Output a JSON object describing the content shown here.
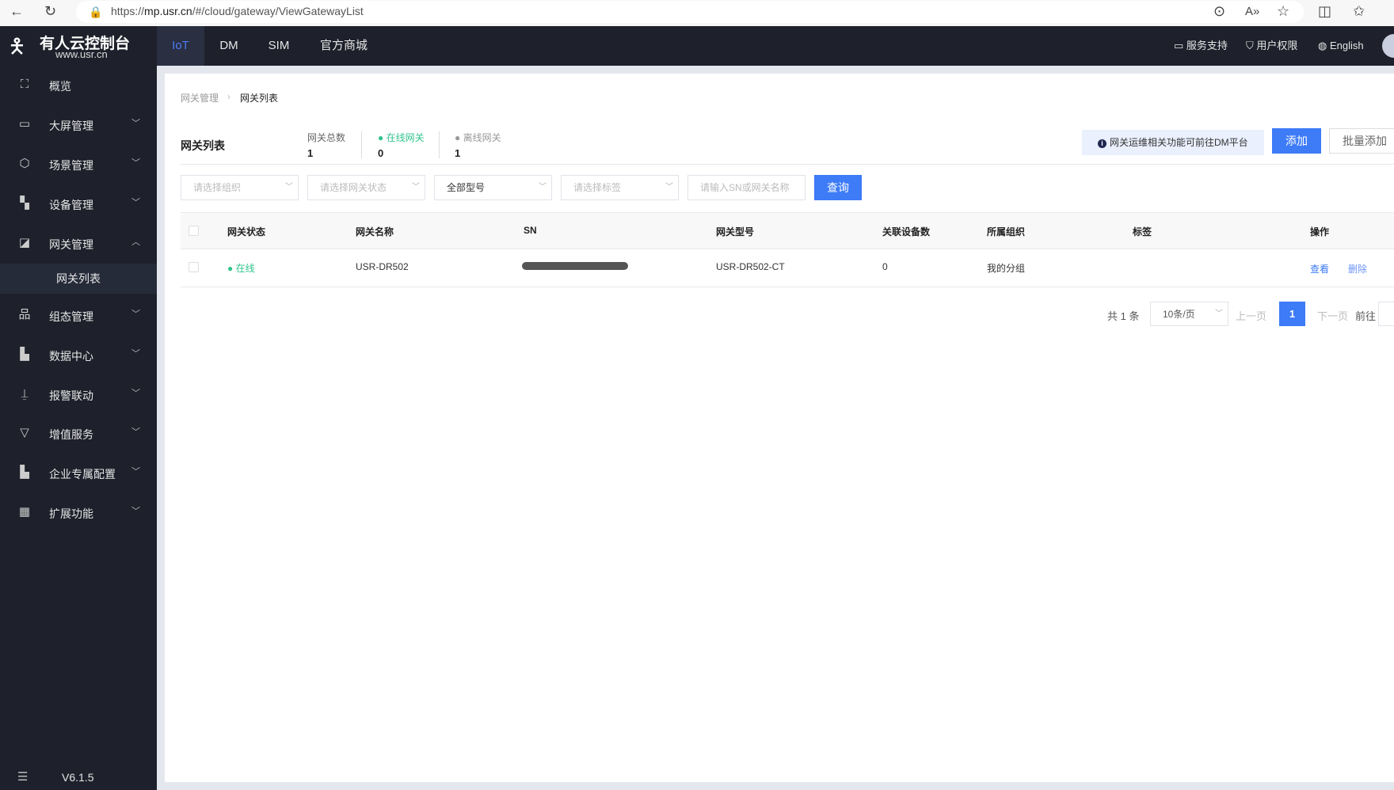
{
  "browser": {
    "url_prefix": "https://",
    "url_host": "mp.usr.cn",
    "url_path": "/#/cloud/gateway/ViewGatewayList"
  },
  "brand": {
    "name": "有人云控制台",
    "site": "www.usr.cn"
  },
  "topnav": {
    "tabs": [
      {
        "label": "IoT",
        "active": true
      },
      {
        "label": "DM"
      },
      {
        "label": "SIM"
      },
      {
        "label": "官方商城"
      }
    ],
    "support": "服务支持",
    "permissions": "用户权限",
    "language": "English"
  },
  "sidebar": {
    "items": [
      {
        "label": "概览",
        "icon": "scan-icon"
      },
      {
        "label": "大屏管理",
        "icon": "monitor-icon"
      },
      {
        "label": "场景管理",
        "icon": "cube-icon"
      },
      {
        "label": "设备管理",
        "icon": "device-grid-icon"
      },
      {
        "label": "网关管理",
        "icon": "chart-window-icon",
        "expanded": true
      },
      {
        "label": "组态管理",
        "icon": "hierarchy-icon"
      },
      {
        "label": "数据中心",
        "icon": "bar-chart-icon"
      },
      {
        "label": "报警联动",
        "icon": "alarm-icon"
      },
      {
        "label": "增值服务",
        "icon": "diamond-icon"
      },
      {
        "label": "企业专属配置",
        "icon": "building-icon"
      },
      {
        "label": "扩展功能",
        "icon": "apps-icon"
      }
    ],
    "sub_active": "网关列表",
    "version": "V6.1.5"
  },
  "breadcrumb": [
    "网关管理",
    "网关列表"
  ],
  "page": {
    "title": "网关列表",
    "stats": [
      {
        "label": "网关总数",
        "value": "1"
      },
      {
        "label": "在线网关",
        "value": "0",
        "color": "#31c48d"
      },
      {
        "label": "离线网关",
        "value": "1",
        "color": "#999999"
      }
    ],
    "notice": "网关运维相关功能可前往DM平台",
    "add": "添加",
    "batch_add": "批量添加"
  },
  "filters": {
    "org": "请选择组织",
    "status": "请选择网关状态",
    "model": "全部型号",
    "tag": "请选择标签",
    "search_placeholder": "请输入SN或网关名称",
    "query": "查询"
  },
  "table": {
    "headers": [
      "网关状态",
      "网关名称",
      "SN",
      "网关型号",
      "关联设备数",
      "所属组织",
      "标签",
      "操作"
    ],
    "rows": [
      {
        "status": "在线",
        "name": "USR-DR502",
        "sn": "",
        "model": "USR-DR502-CT",
        "devices": "0",
        "org": "我的分组",
        "tag": "",
        "view": "查看",
        "delete": "删除"
      }
    ]
  },
  "pagination": {
    "total": "共 1 条",
    "page_size": "10条/页",
    "prev": "上一页",
    "current": "1",
    "next": "下一页",
    "goto": "前往"
  },
  "colors": {
    "accent": "#3d7bf7",
    "sidebar": "#1e212b",
    "online": "#31c48d"
  }
}
